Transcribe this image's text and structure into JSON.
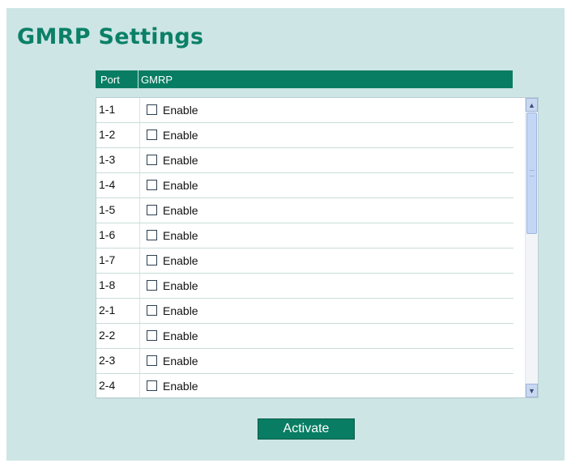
{
  "page": {
    "title": "GMRP Settings"
  },
  "table": {
    "headers": {
      "port": "Port",
      "gmrp": "GMRP"
    },
    "rows": [
      {
        "port": "1-1",
        "label": "Enable",
        "checked": false
      },
      {
        "port": "1-2",
        "label": "Enable",
        "checked": false
      },
      {
        "port": "1-3",
        "label": "Enable",
        "checked": false
      },
      {
        "port": "1-4",
        "label": "Enable",
        "checked": false
      },
      {
        "port": "1-5",
        "label": "Enable",
        "checked": false
      },
      {
        "port": "1-6",
        "label": "Enable",
        "checked": false
      },
      {
        "port": "1-7",
        "label": "Enable",
        "checked": false
      },
      {
        "port": "1-8",
        "label": "Enable",
        "checked": false
      },
      {
        "port": "2-1",
        "label": "Enable",
        "checked": false
      },
      {
        "port": "2-2",
        "label": "Enable",
        "checked": false
      },
      {
        "port": "2-3",
        "label": "Enable",
        "checked": false
      },
      {
        "port": "2-4",
        "label": "Enable",
        "checked": false
      }
    ]
  },
  "scrollbar": {
    "up_icon": "chevron-up-icon",
    "down_icon": "chevron-down-icon"
  },
  "actions": {
    "activate_label": "Activate"
  },
  "colors": {
    "accent": "#087d63",
    "title": "#0b8067",
    "background": "#cde5e5"
  }
}
